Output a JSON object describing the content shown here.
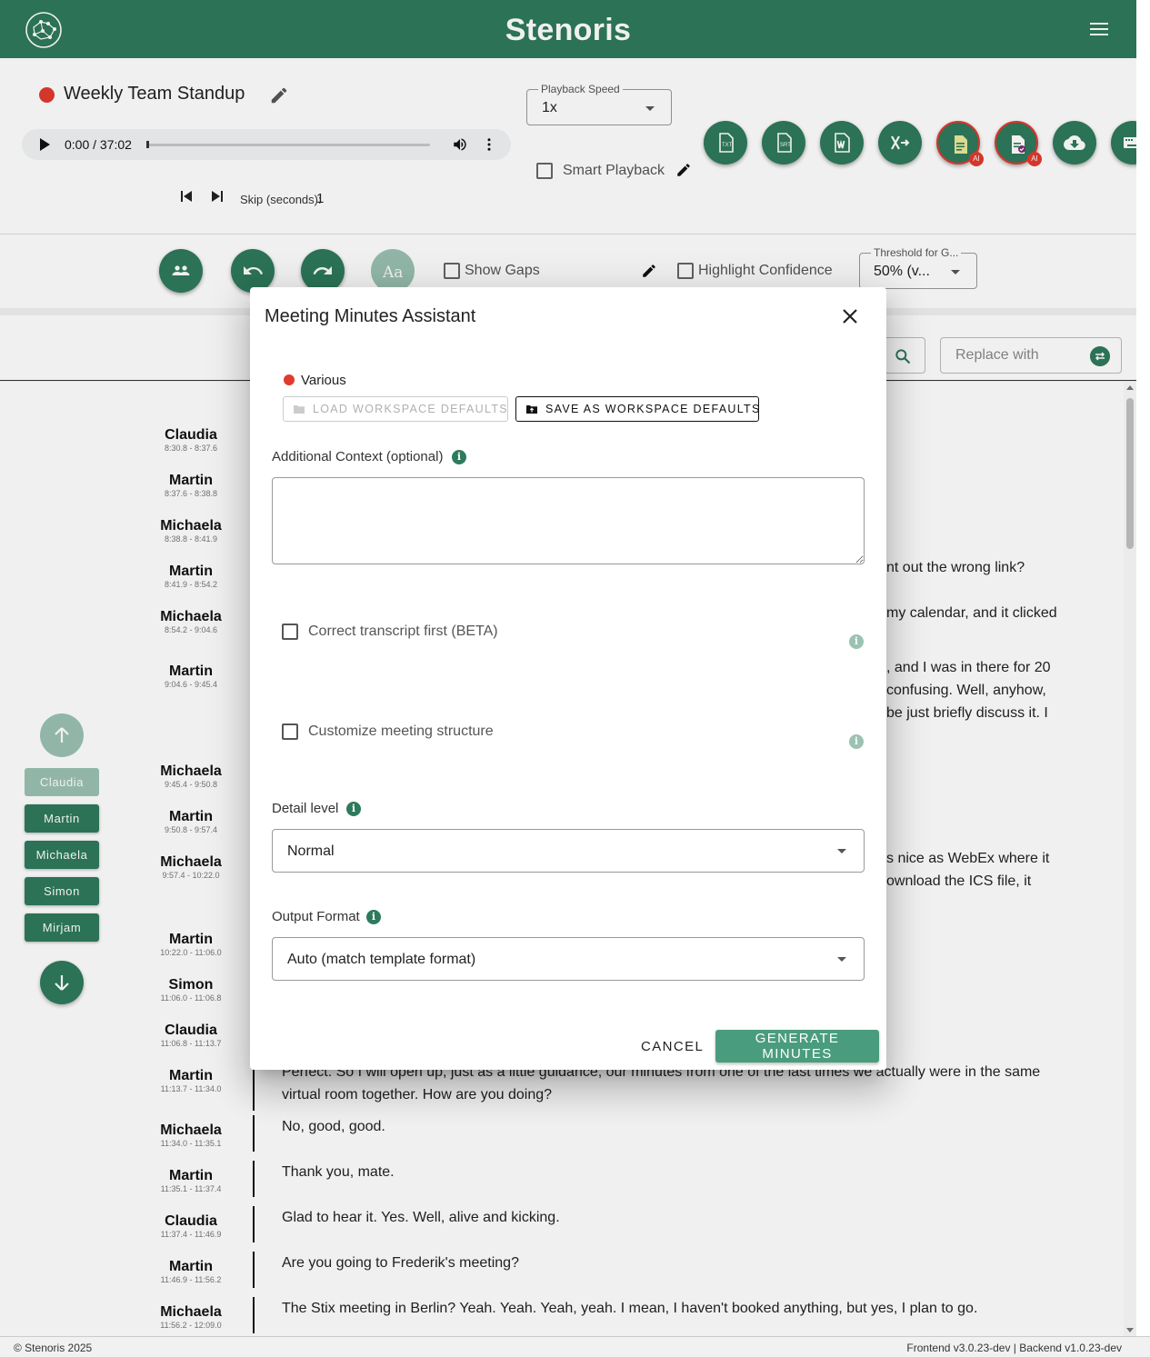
{
  "app": {
    "title": "Stenoris"
  },
  "recording": {
    "title": "Weekly Team Standup"
  },
  "player": {
    "time": "0:00 / 37:02",
    "skip_label": "Skip (seconds):",
    "skip_value": "1"
  },
  "playback_speed": {
    "label": "Playback Speed",
    "value": "1x"
  },
  "smart_playback": {
    "label": "Smart Playback"
  },
  "toolbar": {
    "show_gaps": "Show Gaps",
    "highlight_confidence": "Highlight Confidence",
    "threshold_label": "Threshold for G...",
    "threshold_value": "50% (v..."
  },
  "search": {
    "replace_placeholder": "Replace with"
  },
  "speakers_panel": {
    "speakers": [
      "Claudia",
      "Martin",
      "Michaela",
      "Simon",
      "Mirjam"
    ]
  },
  "transcript": [
    {
      "speaker": "Claudia",
      "time": "8:30.8 - 8:37.6",
      "text": ""
    },
    {
      "speaker": "Martin",
      "time": "8:37.6 - 8:38.8",
      "text": ""
    },
    {
      "speaker": "Michaela",
      "time": "8:38.8 - 8:41.9",
      "text": ""
    },
    {
      "speaker": "Martin",
      "time": "8:41.9 - 8:54.2",
      "text": "nt out the wrong link?"
    },
    {
      "speaker": "Michaela",
      "time": "8:54.2 - 9:04.6",
      "text": "my calendar, and it clicked"
    },
    {
      "speaker": "Martin",
      "time": "9:04.6 - 9:45.4",
      "text": ", and I was in there for 20\nconfusing. Well, anyhow,\nbe just briefly discuss it. I"
    },
    {
      "speaker": "Michaela",
      "time": "9:45.4 - 9:50.8",
      "text": ""
    },
    {
      "speaker": "Martin",
      "time": "9:50.8 - 9:57.4",
      "text": ""
    },
    {
      "speaker": "Michaela",
      "time": "9:57.4 - 10:22.0",
      "text": "s nice as WebEx where it\nownload the ICS file, it"
    },
    {
      "speaker": "Martin",
      "time": "10:22.0 - 11:06.0",
      "text": ""
    },
    {
      "speaker": "Simon",
      "time": "11:06.0 - 11:06.8",
      "text": ""
    },
    {
      "speaker": "Claudia",
      "time": "11:06.8 - 11:13.7",
      "text": ""
    },
    {
      "speaker": "Martin",
      "time": "11:13.7 - 11:34.0",
      "text": "Perfect. So I will open up, just as a little guidance, our minutes from one of the last times we actually were in the same virtual room together. How are you doing?"
    },
    {
      "speaker": "Michaela",
      "time": "11:34.0 - 11:35.1",
      "text": "No, good, good."
    },
    {
      "speaker": "Martin",
      "time": "11:35.1 - 11:37.4",
      "text": "Thank you, mate."
    },
    {
      "speaker": "Claudia",
      "time": "11:37.4 - 11:46.9",
      "text": "Glad to hear it. Yes. Well, alive and kicking."
    },
    {
      "speaker": "Martin",
      "time": "11:46.9 - 11:56.2",
      "text": "Are you going to Frederik's meeting?"
    },
    {
      "speaker": "Michaela",
      "time": "11:56.2 - 12:09.0",
      "text": "The Stix meeting in Berlin? Yeah. Yeah. Yeah, yeah. I mean, I haven't booked anything, but yes, I plan to go."
    }
  ],
  "dialog": {
    "title": "Meeting Minutes Assistant",
    "workspace_name": "Various",
    "load_defaults": "LOAD WORKSPACE DEFAULTS",
    "save_defaults": "SAVE AS WORKSPACE DEFAULTS",
    "context_label": "Additional Context (optional)",
    "correct_transcript": "Correct transcript first (BETA)",
    "customize_structure": "Customize meeting structure",
    "detail_label": "Detail level",
    "detail_value": "Normal",
    "output_label": "Output Format",
    "output_value": "Auto (match template format)",
    "cancel": "CANCEL",
    "generate": "GENERATE MINUTES",
    "info_glyph": "i"
  },
  "footer": {
    "copyright": "© Stenoris 2025",
    "version": "Frontend v3.0.23-dev | Backend v1.0.23-dev"
  },
  "colors": {
    "primary": "#2e7a5c",
    "primary_light": "#9bc2b2",
    "accent_red": "#e23a2e"
  }
}
